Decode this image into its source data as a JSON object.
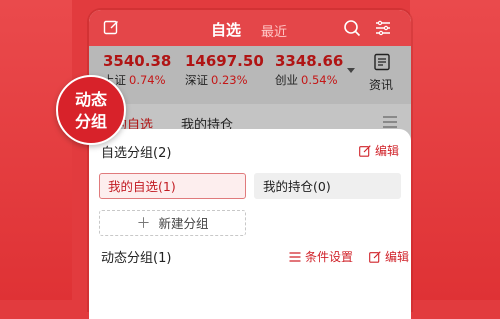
{
  "header": {
    "tab_active": "自选",
    "tab_inactive": "最近"
  },
  "indices": [
    {
      "value": "3540.38",
      "name": "上证",
      "change": "0.74%"
    },
    {
      "value": "14697.50",
      "name": "深证",
      "change": "0.23%"
    },
    {
      "value": "3348.66",
      "name": "创业",
      "change": "0.54%"
    }
  ],
  "news_label": "资讯",
  "subtabs": {
    "active": "我的自选",
    "other": "我的持仓"
  },
  "badge": {
    "line1": "动态",
    "line2": "分组"
  },
  "sheet": {
    "section1_title": "自选分组(2)",
    "section1_edit": "编辑",
    "groups": [
      {
        "label": "我的自选(1)"
      },
      {
        "label": "我的持仓(0)"
      }
    ],
    "new_group": "新建分组",
    "section2_title": "动态分组(1)",
    "condition_settings": "条件设置",
    "section2_edit": "编辑"
  },
  "colors": {
    "brand_red": "#e23b3e",
    "accent_red": "#d0232a"
  }
}
